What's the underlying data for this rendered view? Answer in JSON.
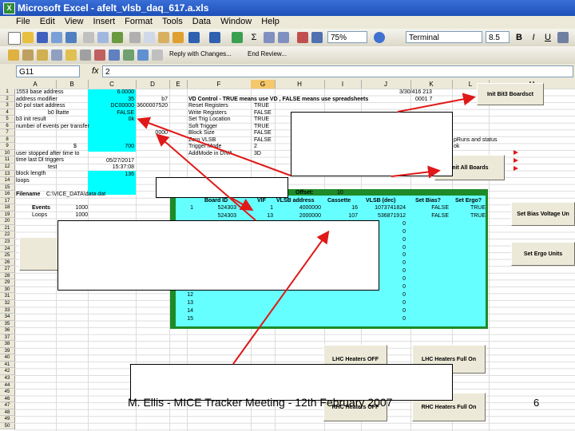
{
  "window": {
    "title": "Microsoft Excel - afelt_vlsb_daq_617.a.xls"
  },
  "menu": [
    "File",
    "Edit",
    "View",
    "Insert",
    "Format",
    "Tools",
    "Data",
    "Window",
    "Help"
  ],
  "toolbar": {
    "zoom": "75%",
    "font": "Terminal",
    "size": "8.5",
    "bold": "B",
    "italic": "I",
    "underline": "U",
    "reply": "Reply with Changes...",
    "end_review": "End Review..."
  },
  "formula": {
    "name_box": "G11",
    "fx": "fx",
    "value": "2"
  },
  "columns": [
    "A",
    "B",
    "C",
    "D",
    "E",
    "F",
    "G",
    "H",
    "I",
    "J",
    "K",
    "L",
    "M"
  ],
  "left_cells": {
    "r1": "1553 base address",
    "r2": "address modifier",
    "r3": "b0 pol start address",
    "r4": "b0 lltatte",
    "r5": "b3 init result",
    "r6": "number of events per transfer",
    "r9": "$",
    "r10": "user stopped after time to",
    "r11": "time last Dl triggers",
    "r12": "test",
    "r13": "block length",
    "r14": "loops",
    "r16": "Filename",
    "r16b": "C:\\VICE_DATA\\data.dat",
    "r17": "Events",
    "r18": "Loops"
  },
  "col_c": [
    "6.0000",
    "35",
    "DC00000",
    "FALSE",
    "0k",
    "",
    "",
    "",
    "700",
    "",
    "05/27/2017",
    "15:37:08",
    "136",
    ""
  ],
  "col_d": [
    "",
    "b7",
    "3600007520",
    "",
    "",
    "",
    "0000"
  ],
  "events": "1000",
  "loops_val": "1000",
  "vd_control": {
    "title": "VD Control  - TRUE means use VD , FALSE means use spreadsheets",
    "rows": [
      {
        "label": "Reset Registers",
        "val": "TRUE"
      },
      {
        "label": "Write Registers",
        "val": "FALSE"
      },
      {
        "label": "Set Trig Location",
        "val": "TRUE"
      },
      {
        "label": "Soft Trigger",
        "val": "TRUE"
      },
      {
        "label": "Block Size",
        "val": "FALSE"
      },
      {
        "label": "Zero VLSB",
        "val": "FALSE"
      },
      {
        "label": "Trigger Mode",
        "val": "2"
      },
      {
        "label": "AddMode in DIVA",
        "val": "3D"
      }
    ]
  },
  "j_col": {
    "r2": "3/30/416 213",
    "r3": "0001 7"
  },
  "offset": {
    "label": "Offset:",
    "value": "10"
  },
  "table": {
    "headers": [
      "Board ID",
      "VIF",
      "VLSB address",
      "Cassette",
      "VLSB (dec)",
      "Set Bias?",
      "Set Ergo?"
    ],
    "rows": [
      [
        "1",
        "524303",
        "1",
        "4000000",
        "16",
        "1073741824",
        "FALSE",
        "TRUE"
      ],
      [
        "",
        "524303",
        "13",
        "2000000",
        "107",
        "536871912",
        "FALSE",
        "TRUE"
      ],
      [
        "",
        "",
        "",
        "",
        "",
        "0",
        "",
        ""
      ],
      [
        "",
        "",
        "",
        "",
        "",
        "0",
        "",
        ""
      ],
      [
        "",
        "",
        "",
        "",
        "",
        "0",
        "",
        ""
      ],
      [
        "",
        "",
        "",
        "",
        "",
        "0",
        "",
        ""
      ],
      [
        "",
        "",
        "",
        "",
        "",
        "0",
        "",
        ""
      ],
      [
        "",
        "",
        "",
        "",
        "",
        "0",
        "",
        ""
      ],
      [
        "",
        "",
        "",
        "",
        "",
        "0",
        "",
        ""
      ],
      [
        "",
        "",
        "",
        "",
        "",
        "0",
        "",
        ""
      ],
      [
        "",
        "",
        "",
        "",
        "",
        "0",
        "",
        ""
      ],
      [
        "12",
        "",
        "",
        "",
        "",
        "0",
        "",
        ""
      ],
      [
        "13",
        "",
        "",
        "",
        "",
        "0",
        "",
        ""
      ],
      [
        "14",
        "",
        "",
        "",
        "",
        "0",
        "",
        ""
      ],
      [
        "15",
        "",
        "",
        "",
        "",
        "0",
        "",
        ""
      ]
    ]
  },
  "buttons": {
    "init_bb": "Init Bit3 Boardsct",
    "init_all": "Init All Boards",
    "set_bias": "Set Bias Voltage Un",
    "set_ergo": "Set Ergo Units",
    "lhc_off": "LHC Heaters OFF",
    "lhc_on": "LHC Heaters Full On",
    "rhc_off": "RHC Heaters OFF",
    "rhc_on": "RHC Heaters Full On"
  },
  "right_labels": {
    "r8": "pRuns and status",
    "r9": "ok"
  },
  "footer": {
    "text": "M. Ellis - MICE Tracker Meeting - 12th February 2007",
    "page": "6"
  },
  "colors": {
    "arrow": "#e01818",
    "cyan": "#00ffff",
    "table_border": "#1e8a28"
  }
}
